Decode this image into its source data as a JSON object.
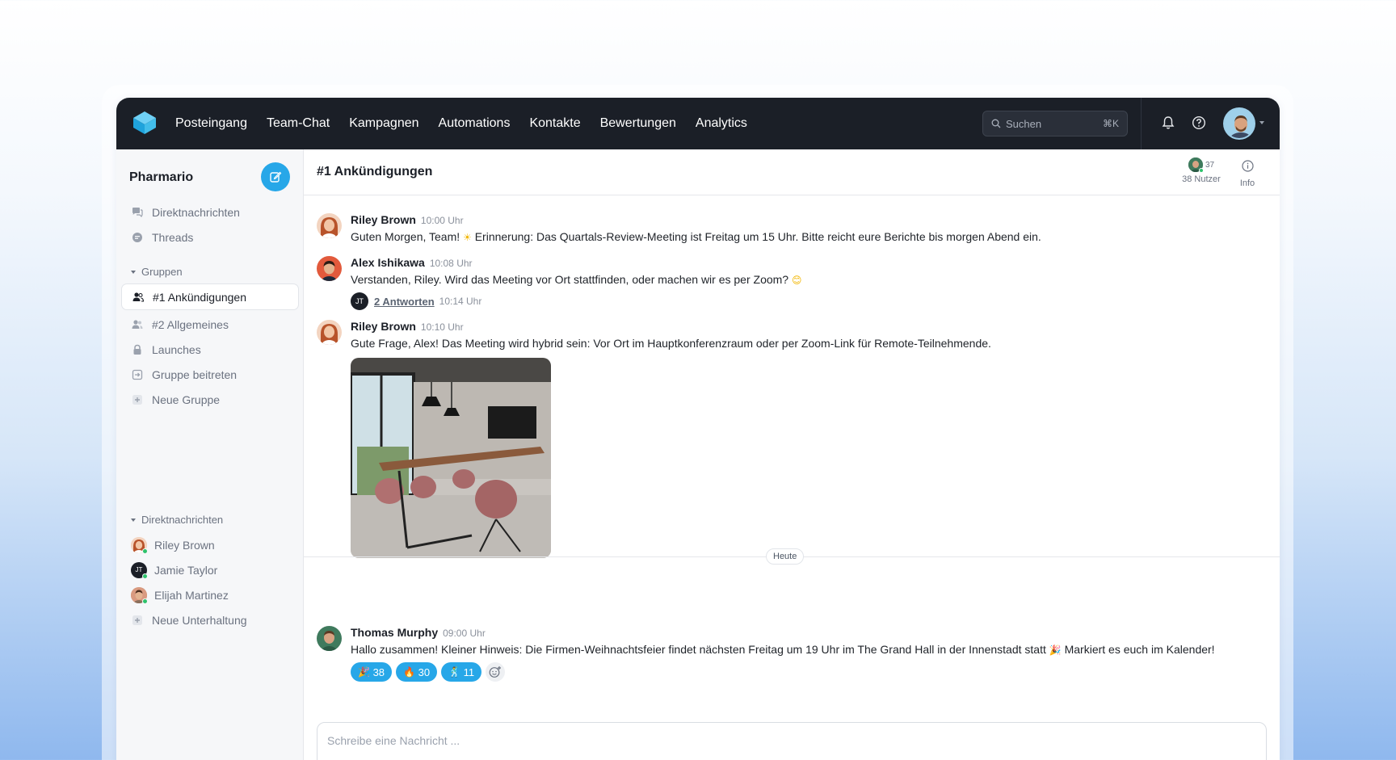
{
  "nav": {
    "items": [
      "Posteingang",
      "Team-Chat",
      "Kampagnen",
      "Automations",
      "Kontakte",
      "Bewertungen",
      "Analytics"
    ],
    "search_placeholder": "Suchen",
    "search_shortcut": "⌘K"
  },
  "sidebar": {
    "workspace": "Pharmario",
    "top_items": [
      {
        "label": "Direktnachrichten",
        "icon": "chat-bubbles-icon"
      },
      {
        "label": "Threads",
        "icon": "thread-icon"
      }
    ],
    "groups_header": "Gruppen",
    "groups": [
      {
        "label": "#1 Ankündigungen",
        "icon": "users-icon",
        "active": true
      },
      {
        "label": "#2 Allgemeines",
        "icon": "users-icon"
      },
      {
        "label": "Launches",
        "icon": "lock-icon"
      },
      {
        "label": "Gruppe beitreten",
        "icon": "join-icon"
      },
      {
        "label": "Neue Gruppe",
        "icon": "plus-icon"
      }
    ],
    "dm_header": "Direktnachrichten",
    "dms": [
      {
        "label": "Riley Brown",
        "avatar": "riley"
      },
      {
        "label": "Jamie Taylor",
        "avatar": "JT"
      },
      {
        "label": "Elijah Martinez",
        "avatar": "elijah"
      },
      {
        "label": "Neue Unterhaltung",
        "icon": "plus-icon"
      }
    ]
  },
  "channel": {
    "title": "#1 Ankündigungen",
    "members_count": "37",
    "members_label": "38 Nutzer",
    "info_label": "Info"
  },
  "messages": [
    {
      "author": "Riley Brown",
      "time": "10:00 Uhr",
      "text_before": "Guten Morgen, Team! ",
      "emoji": "☀",
      "text_after": " Erinnerung: Das Quartals-Review-Meeting ist Freitag um 15 Uhr. Bitte reicht eure Berichte bis morgen Abend ein."
    },
    {
      "author": "Alex Ishikawa",
      "time": "10:08 Uhr",
      "text_before": "Verstanden, Riley. Wird das Meeting vor Ort stattfinden, oder machen wir es per Zoom? ",
      "emoji": "😊",
      "text_after": "",
      "thread_avatar": "JT",
      "thread_replies": "2 Antworten",
      "thread_time": "10:14 Uhr"
    },
    {
      "author": "Riley Brown",
      "time": "10:10 Uhr",
      "text_before": "Gute Frage, Alex! Das Meeting wird hybrid sein: Vor Ort im Hauptkonferenzraum oder per Zoom-Link für Remote-Teilnehmende.",
      "emoji": "",
      "text_after": ""
    },
    {
      "author": "Thomas Murphy",
      "time": "09:00 Uhr",
      "text_before": "Hallo zusammen! Kleiner Hinweis: Die Firmen-Weihnachtsfeier findet nächsten Freitag um 19 Uhr im The Grand Hall in der Innenstadt statt ",
      "emoji": "🎉",
      "text_after": " Markiert es euch im Kalender!"
    }
  ],
  "day_divider": "Heute",
  "reactions": [
    {
      "emoji": "🎉",
      "count": "38"
    },
    {
      "emoji": "🔥",
      "count": "30"
    },
    {
      "emoji": "🕺",
      "count": "11"
    }
  ],
  "composer_placeholder": "Schreibe eine Nachricht ...",
  "colors": {
    "accent": "#27a7e8",
    "topbar": "#1b1f27",
    "online": "#2dc26b"
  }
}
